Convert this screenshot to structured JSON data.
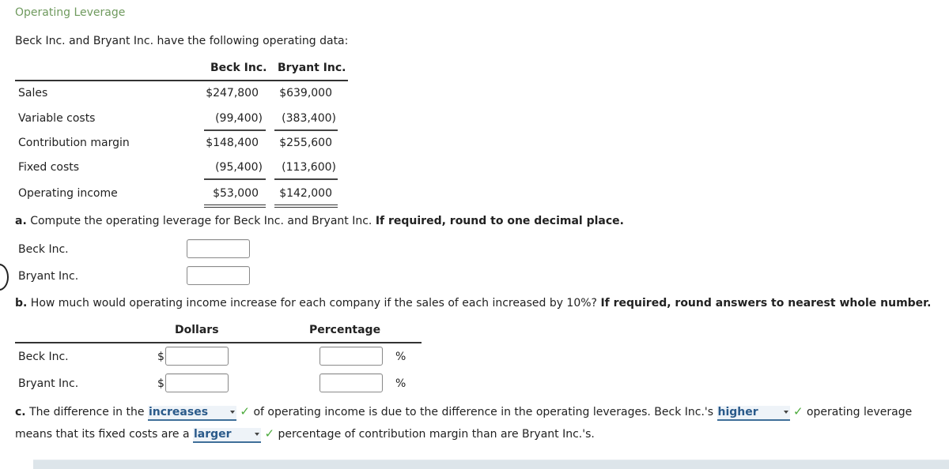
{
  "title": "Operating Leverage",
  "intro": "Beck Inc. and Bryant Inc. have the following operating data:",
  "table": {
    "columns": [
      "Beck Inc.",
      "Bryant Inc."
    ],
    "rows": [
      {
        "label": "Sales",
        "beck": "$247,800",
        "bryant": "$639,000"
      },
      {
        "label": "Variable costs",
        "beck": "(99,400)",
        "bryant": "(383,400)"
      },
      {
        "label": "Contribution margin",
        "beck": "$148,400",
        "bryant": "$255,600"
      },
      {
        "label": "Fixed costs",
        "beck": "(95,400)",
        "bryant": "(113,600)"
      },
      {
        "label": "Operating income",
        "beck": "$53,000",
        "bryant": "$142,000"
      }
    ]
  },
  "part_a": {
    "letter": "a.",
    "text": "Compute the operating leverage for Beck Inc. and Bryant Inc.",
    "instruction": "If required, round to one decimal place.",
    "rows": [
      {
        "label": "Beck Inc.",
        "value": ""
      },
      {
        "label": "Bryant Inc.",
        "value": ""
      }
    ]
  },
  "part_b": {
    "letter": "b.",
    "text": "How much would operating income increase for each company if the sales of each increased by 10%?",
    "instruction": "If required, round answers to nearest whole number.",
    "col_dollars": "Dollars",
    "col_percentage": "Percentage",
    "currency_symbol": "$",
    "percent_symbol": "%",
    "rows": [
      {
        "label": "Beck Inc.",
        "dollars": "",
        "percentage": ""
      },
      {
        "label": "Bryant Inc.",
        "dollars": "",
        "percentage": ""
      }
    ]
  },
  "part_c": {
    "letter": "c.",
    "seg1": "The difference in the",
    "select1": "increases",
    "seg2": "of operating income is due to the difference in the operating leverages. Beck Inc.'s",
    "select2": "higher",
    "seg3": "operating leverage",
    "seg4": "means that its fixed costs are a",
    "select3": "larger",
    "seg5": "percentage of contribution margin than are Bryant Inc.'s.",
    "check": "✓"
  },
  "colors": {
    "title": "#6f9a5e",
    "select_text": "#2a5a8a",
    "check": "#4caa3c"
  }
}
